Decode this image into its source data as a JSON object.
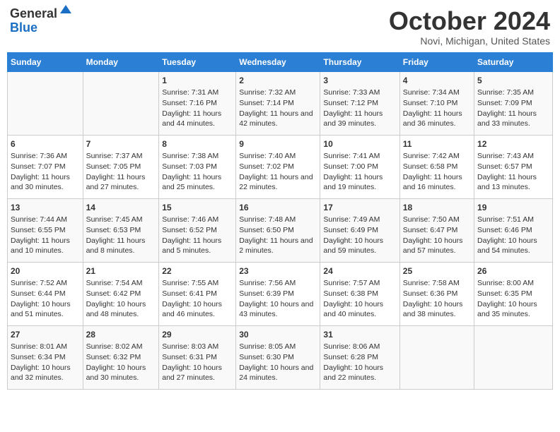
{
  "header": {
    "logo_general": "General",
    "logo_blue": "Blue",
    "month_title": "October 2024",
    "location": "Novi, Michigan, United States"
  },
  "days_of_week": [
    "Sunday",
    "Monday",
    "Tuesday",
    "Wednesday",
    "Thursday",
    "Friday",
    "Saturday"
  ],
  "weeks": [
    [
      {
        "day": "",
        "info": ""
      },
      {
        "day": "",
        "info": ""
      },
      {
        "day": "1",
        "info": "Sunrise: 7:31 AM\nSunset: 7:16 PM\nDaylight: 11 hours and 44 minutes."
      },
      {
        "day": "2",
        "info": "Sunrise: 7:32 AM\nSunset: 7:14 PM\nDaylight: 11 hours and 42 minutes."
      },
      {
        "day": "3",
        "info": "Sunrise: 7:33 AM\nSunset: 7:12 PM\nDaylight: 11 hours and 39 minutes."
      },
      {
        "day": "4",
        "info": "Sunrise: 7:34 AM\nSunset: 7:10 PM\nDaylight: 11 hours and 36 minutes."
      },
      {
        "day": "5",
        "info": "Sunrise: 7:35 AM\nSunset: 7:09 PM\nDaylight: 11 hours and 33 minutes."
      }
    ],
    [
      {
        "day": "6",
        "info": "Sunrise: 7:36 AM\nSunset: 7:07 PM\nDaylight: 11 hours and 30 minutes."
      },
      {
        "day": "7",
        "info": "Sunrise: 7:37 AM\nSunset: 7:05 PM\nDaylight: 11 hours and 27 minutes."
      },
      {
        "day": "8",
        "info": "Sunrise: 7:38 AM\nSunset: 7:03 PM\nDaylight: 11 hours and 25 minutes."
      },
      {
        "day": "9",
        "info": "Sunrise: 7:40 AM\nSunset: 7:02 PM\nDaylight: 11 hours and 22 minutes."
      },
      {
        "day": "10",
        "info": "Sunrise: 7:41 AM\nSunset: 7:00 PM\nDaylight: 11 hours and 19 minutes."
      },
      {
        "day": "11",
        "info": "Sunrise: 7:42 AM\nSunset: 6:58 PM\nDaylight: 11 hours and 16 minutes."
      },
      {
        "day": "12",
        "info": "Sunrise: 7:43 AM\nSunset: 6:57 PM\nDaylight: 11 hours and 13 minutes."
      }
    ],
    [
      {
        "day": "13",
        "info": "Sunrise: 7:44 AM\nSunset: 6:55 PM\nDaylight: 11 hours and 10 minutes."
      },
      {
        "day": "14",
        "info": "Sunrise: 7:45 AM\nSunset: 6:53 PM\nDaylight: 11 hours and 8 minutes."
      },
      {
        "day": "15",
        "info": "Sunrise: 7:46 AM\nSunset: 6:52 PM\nDaylight: 11 hours and 5 minutes."
      },
      {
        "day": "16",
        "info": "Sunrise: 7:48 AM\nSunset: 6:50 PM\nDaylight: 11 hours and 2 minutes."
      },
      {
        "day": "17",
        "info": "Sunrise: 7:49 AM\nSunset: 6:49 PM\nDaylight: 10 hours and 59 minutes."
      },
      {
        "day": "18",
        "info": "Sunrise: 7:50 AM\nSunset: 6:47 PM\nDaylight: 10 hours and 57 minutes."
      },
      {
        "day": "19",
        "info": "Sunrise: 7:51 AM\nSunset: 6:46 PM\nDaylight: 10 hours and 54 minutes."
      }
    ],
    [
      {
        "day": "20",
        "info": "Sunrise: 7:52 AM\nSunset: 6:44 PM\nDaylight: 10 hours and 51 minutes."
      },
      {
        "day": "21",
        "info": "Sunrise: 7:54 AM\nSunset: 6:42 PM\nDaylight: 10 hours and 48 minutes."
      },
      {
        "day": "22",
        "info": "Sunrise: 7:55 AM\nSunset: 6:41 PM\nDaylight: 10 hours and 46 minutes."
      },
      {
        "day": "23",
        "info": "Sunrise: 7:56 AM\nSunset: 6:39 PM\nDaylight: 10 hours and 43 minutes."
      },
      {
        "day": "24",
        "info": "Sunrise: 7:57 AM\nSunset: 6:38 PM\nDaylight: 10 hours and 40 minutes."
      },
      {
        "day": "25",
        "info": "Sunrise: 7:58 AM\nSunset: 6:36 PM\nDaylight: 10 hours and 38 minutes."
      },
      {
        "day": "26",
        "info": "Sunrise: 8:00 AM\nSunset: 6:35 PM\nDaylight: 10 hours and 35 minutes."
      }
    ],
    [
      {
        "day": "27",
        "info": "Sunrise: 8:01 AM\nSunset: 6:34 PM\nDaylight: 10 hours and 32 minutes."
      },
      {
        "day": "28",
        "info": "Sunrise: 8:02 AM\nSunset: 6:32 PM\nDaylight: 10 hours and 30 minutes."
      },
      {
        "day": "29",
        "info": "Sunrise: 8:03 AM\nSunset: 6:31 PM\nDaylight: 10 hours and 27 minutes."
      },
      {
        "day": "30",
        "info": "Sunrise: 8:05 AM\nSunset: 6:30 PM\nDaylight: 10 hours and 24 minutes."
      },
      {
        "day": "31",
        "info": "Sunrise: 8:06 AM\nSunset: 6:28 PM\nDaylight: 10 hours and 22 minutes."
      },
      {
        "day": "",
        "info": ""
      },
      {
        "day": "",
        "info": ""
      }
    ]
  ]
}
